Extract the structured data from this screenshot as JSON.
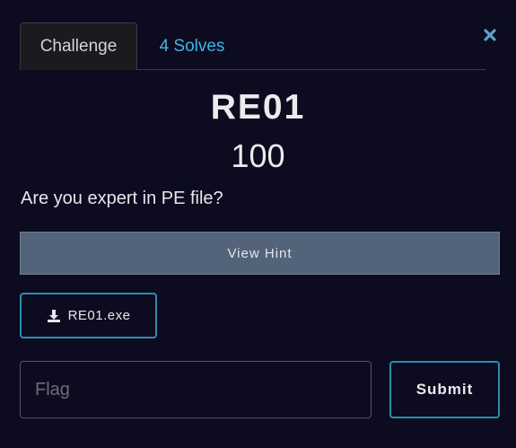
{
  "tabs": {
    "challenge": "Challenge",
    "solves": "4 Solves"
  },
  "challenge": {
    "name": "RE01",
    "points": "100",
    "description": "Are you expert in PE file?"
  },
  "hint": {
    "label": "View Hint"
  },
  "file": {
    "name": "RE01.exe",
    "icon": "download-icon"
  },
  "flag": {
    "placeholder": "Flag",
    "value": ""
  },
  "submit": {
    "label": "Submit"
  },
  "close": {
    "icon": "close-icon"
  },
  "colors": {
    "background": "#0c0b1f",
    "accent": "#2b8fb0",
    "link": "#40b4e8",
    "hint_button": "#52637a"
  }
}
